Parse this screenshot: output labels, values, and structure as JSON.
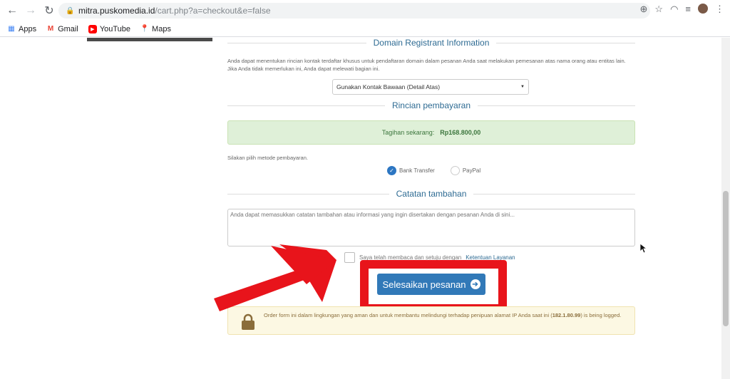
{
  "browser": {
    "url_host": "mitra.puskomedia.id",
    "url_path": "/cart.php?a=checkout&e=false",
    "nav_icons": [
      "back-icon",
      "forward-icon",
      "reload-icon"
    ],
    "right_icons": [
      "zoom-icon",
      "star-icon",
      "extension-icon",
      "menu-icon"
    ]
  },
  "bookmarks": [
    {
      "label": "Apps",
      "icon": "apps-icon"
    },
    {
      "label": "Gmail",
      "icon": "gmail-icon"
    },
    {
      "label": "YouTube",
      "icon": "youtube-icon"
    },
    {
      "label": "Maps",
      "icon": "maps-icon"
    }
  ],
  "registrant": {
    "title": "Domain Registrant Information",
    "description": "Anda dapat menentukan rincian kontak terdaftar khusus untuk pendaftaran domain dalam pesanan Anda saat melakukan pemesanan atas nama orang atau entitas lain. Jika Anda tidak memerlukan ini, Anda dapat melewati bagian ini.",
    "select_value": "Gunakan Kontak Bawaan (Detail Atas)"
  },
  "payment": {
    "title": "Rincian pembayaran",
    "due_label": "Tagihan sekarang:",
    "due_amount": "Rp168.800,00",
    "method_prompt": "Silakan pilih metode pembayaran.",
    "methods": [
      {
        "label": "Bank Transfer",
        "selected": true
      },
      {
        "label": "PayPal",
        "selected": false
      }
    ]
  },
  "notes": {
    "title": "Catatan tambahan",
    "placeholder": "Anda dapat memasukkan catatan tambahan atau informasi yang ingin disertakan dengan pesanan Anda di sini..."
  },
  "tos": {
    "text": "Saya telah membaca dan setuju dengan",
    "link": "Ketentuan Layanan"
  },
  "submit": {
    "label": "Selesaikan pesanan"
  },
  "security_notice": {
    "text_before": "Order form ini dalam lingkungan yang aman dan untuk membantu melindungi terhadap penipuan alamat IP Anda saat ini (",
    "ip": "182.1.80.99",
    "text_after": ") is being logged."
  },
  "colors": {
    "annotation_red": "#e8141b",
    "primary_blue": "#3179b8",
    "success_bg": "#dff0d8",
    "warning_bg": "#fcf8e3"
  }
}
